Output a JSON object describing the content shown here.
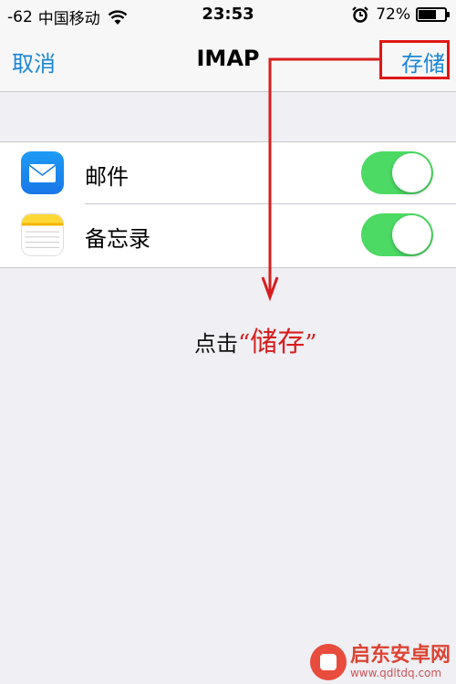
{
  "status_bar": {
    "signal": "-62",
    "carrier": "中国移动",
    "time": "23:53",
    "battery_percent_text": "72%",
    "battery_level": 0.72
  },
  "nav": {
    "cancel_label": "取消",
    "title": "IMAP",
    "save_label": "存储"
  },
  "settings": {
    "items": [
      {
        "label": "邮件",
        "icon": "mail-icon",
        "enabled": true
      },
      {
        "label": "备忘录",
        "icon": "notes-icon",
        "enabled": true
      }
    ]
  },
  "annotation": {
    "prefix": "点击",
    "open_quote": "“",
    "highlight": "储存",
    "close_quote": "”"
  },
  "watermark": {
    "name": "启东安卓网",
    "url": "www.qdltdq.com"
  },
  "colors": {
    "accent": "#1b86d6",
    "toggle_on": "#4cd964",
    "annotation_red": "#d81e1e"
  }
}
